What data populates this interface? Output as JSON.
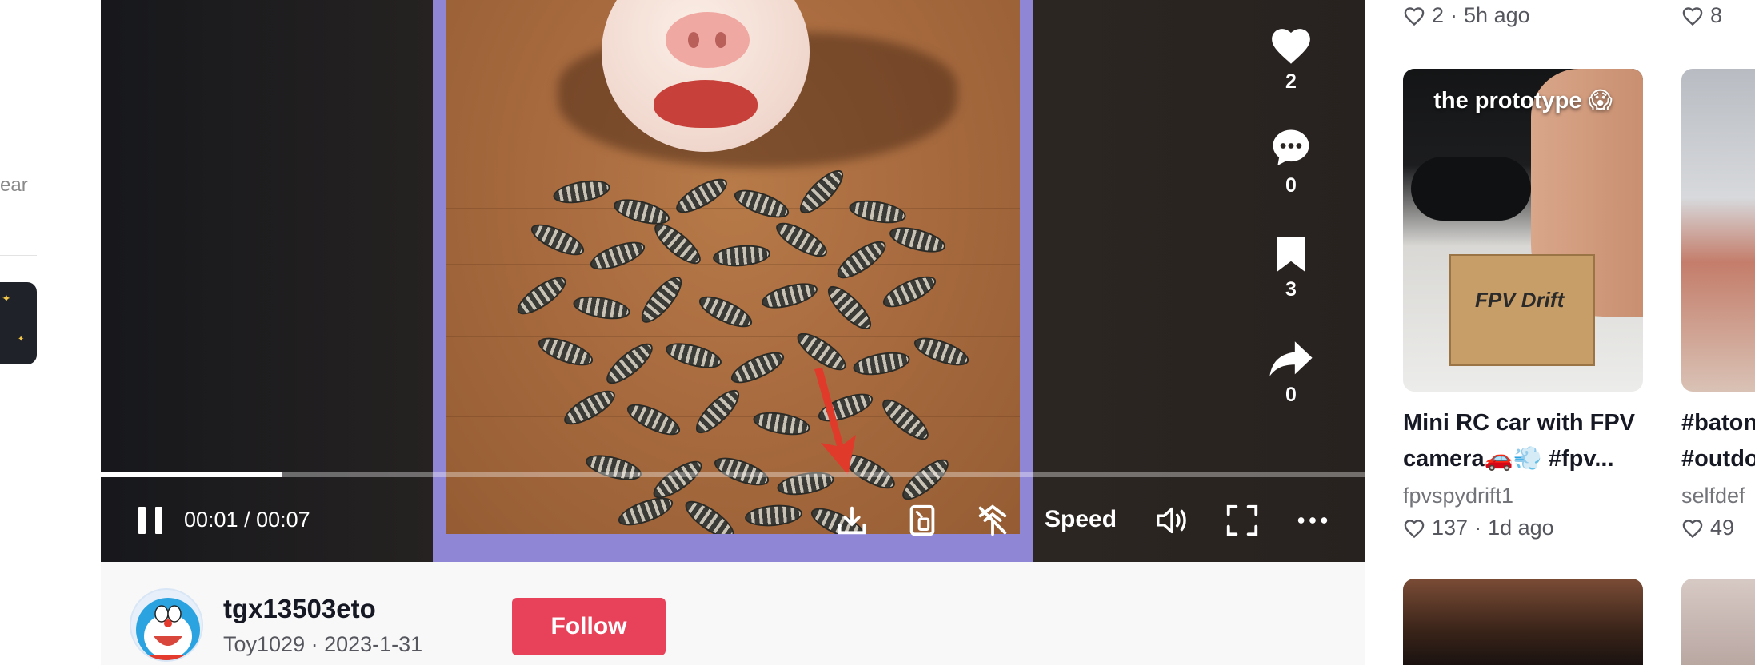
{
  "sidebar": {
    "partial_text": "ear"
  },
  "player": {
    "likes": "2",
    "comments": "0",
    "saves": "3",
    "shares": "0",
    "current_time": "00:01",
    "duration": "00:07",
    "time_separator": " / ",
    "progress_fraction": 0.143,
    "speed_label": "Speed",
    "controls": [
      "pause-icon",
      "download-icon",
      "picture-in-picture-icon",
      "auto-scroll-icon",
      "volume-icon",
      "fullscreen-icon",
      "more-icon"
    ]
  },
  "author": {
    "username": "tgx13503eto",
    "nickname": "Toy1029",
    "meta_separator": " · ",
    "date": "2023-1-31",
    "follow_label": "Follow"
  },
  "recommendations": {
    "top_row": [
      {
        "likes": "2",
        "sep": "·",
        "age": "5h ago"
      },
      {
        "likes": "8"
      }
    ],
    "items": [
      {
        "overlay_text": "the prototype 😱",
        "box_text": "FPV Drift",
        "title": "Mini RC car with FPV camera🚗💨 #fpv...",
        "author": "fpvspydrift1",
        "likes": "137",
        "sep": "·",
        "age": "1d ago"
      },
      {
        "title": "#baton #outdo",
        "author": "selfdef",
        "likes": "49"
      }
    ]
  },
  "colors": {
    "follow_button": "#e8425a",
    "video_frame": "#8f86d6",
    "annotation_arrow": "#e03a2b"
  }
}
